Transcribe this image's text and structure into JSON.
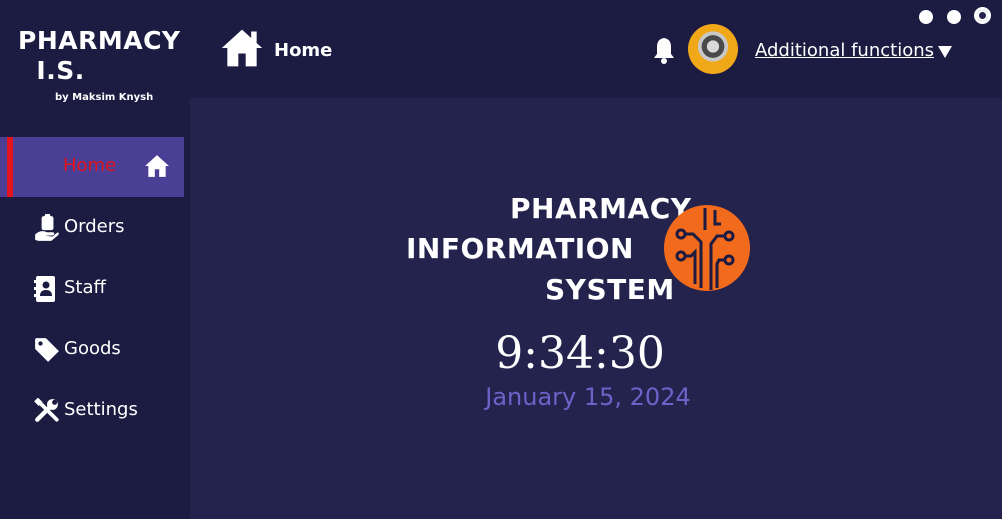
{
  "window": {
    "controls": [
      "minimize-button",
      "maximize-button",
      "close-button"
    ]
  },
  "brand": {
    "title": "PHARMACY\n  I.S.",
    "subtitle": "by Maksim Knysh"
  },
  "sidebar": {
    "items": [
      {
        "label": "Home",
        "icon": "home-icon",
        "active": true
      },
      {
        "label": "Orders",
        "icon": "clipboard-hand-icon",
        "active": false
      },
      {
        "label": "Staff",
        "icon": "contact-book-icon",
        "active": false
      },
      {
        "label": "Goods",
        "icon": "tag-icon",
        "active": false
      },
      {
        "label": "Settings",
        "icon": "tools-icon",
        "active": false
      }
    ]
  },
  "header": {
    "title": "Home",
    "additional_functions": "Additional functions"
  },
  "logo": {
    "line1": "PHARMACY",
    "line2": "INFORMATION",
    "line3": "SYSTEM"
  },
  "clock": {
    "time": "9:34:30",
    "date": "January 15, 2024"
  },
  "colors": {
    "background": "#24234d",
    "sidebar": "#1c1b42",
    "active_item": "#4a3f94",
    "active_accent": "#e3141e",
    "logo_orange": "#f26a1b",
    "date_color": "#6c62c8"
  }
}
